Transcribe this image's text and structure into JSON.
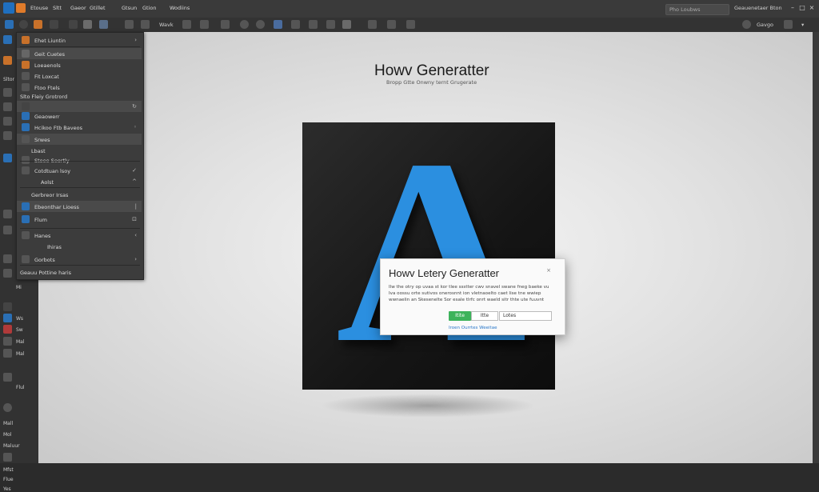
{
  "menubar": {
    "items": [
      "Etouse",
      "Sltt",
      "Gaeor",
      "Gtillet",
      "Gtsun",
      "Gtion",
      "Wodiins"
    ],
    "search_placeholder": "Pho Loubws",
    "right_label": "Geauenetaer Bton"
  },
  "toolbar": {
    "label_1": "Wavk",
    "right_label": "Gavgo"
  },
  "layers_panel": {
    "rows": [
      {
        "label": "Ehet Liuntin"
      },
      {
        "label": "Geit Cuetes"
      },
      {
        "label": "Loeaenols"
      },
      {
        "label": "Fit Loxcat"
      },
      {
        "label": "Ftoo Ftels"
      },
      {
        "label": "Slto Fleiy Grotrord"
      },
      {
        "label": "Geaowerr"
      },
      {
        "label": "Hcikoo Ftb Baveos"
      },
      {
        "label": "Srwes"
      },
      {
        "label": "Lbast"
      },
      {
        "label": "Stoee Seortly"
      },
      {
        "label": "Cotdtuan lsoy"
      },
      {
        "label": "Aolst"
      },
      {
        "label": "Gerbreor Irsas"
      },
      {
        "label": "Ebeonthar Lioess"
      },
      {
        "label": "Flum"
      },
      {
        "label": "Hanes"
      },
      {
        "label": "Ihiras"
      },
      {
        "label": "Gorbots"
      },
      {
        "label": "Geauu Pottine haris"
      }
    ]
  },
  "toolstrip": {
    "labels": [
      "Sltor",
      "Mi",
      "Ws",
      "Sw",
      "Mal",
      "Mal",
      "Flul",
      "Mall",
      "Mol",
      "Maluur",
      "Mfst",
      "Flue",
      "Yes"
    ]
  },
  "canvas": {
    "title": "Howv Generatter",
    "subtitle": "Bropp Gtte Onwny ternt Grugerate",
    "artboard_glyph": "A"
  },
  "dialog": {
    "title": "Howv Letery Generatter",
    "close": "×",
    "body": "Ilw the otry op uvaa st kor tlee ssstter cwv snavel swane fneg baeke vu Iva oossu orte sutivos onerosnnt ion vletnaoelto caet Iise tne wwiep wwnaelin an Skesenelte Sor esale tlrfc onrt waeld sitr thte ute fuuvnt",
    "ok_label": "Itite",
    "cancel_label": "Itte",
    "input_value": "Lotes",
    "link_text": "Iroen Ourrtes Weeitae"
  },
  "colors": {
    "accent_blue": "#2b8fe0",
    "ok_green": "#3db35b",
    "panel_bg": "#3c3c3c"
  }
}
